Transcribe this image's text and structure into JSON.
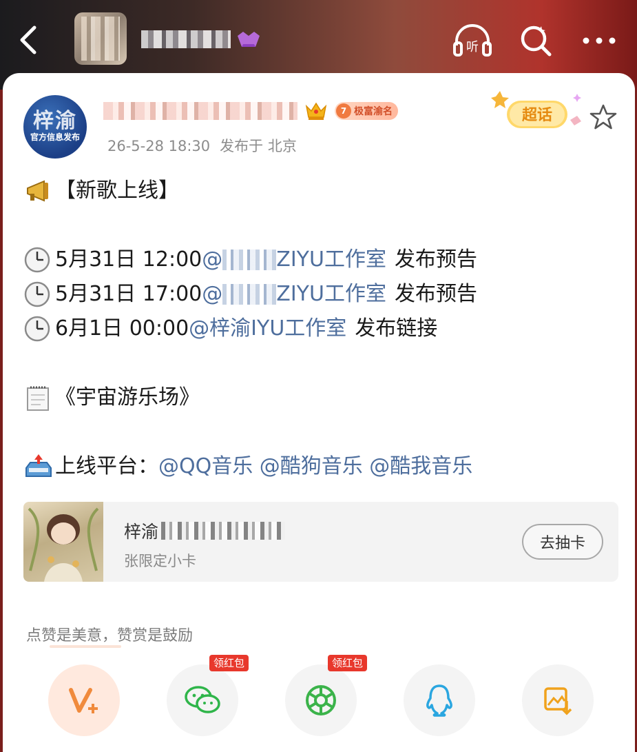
{
  "header": {
    "listen_label": "听"
  },
  "post": {
    "avatar_text_big": "梓渝",
    "avatar_text_small": "官方信息发布",
    "badge_level": "7",
    "badge_label": "极富渝名",
    "timestamp": "26-5-28 18:30",
    "location": "发布于 北京",
    "supertopic_label": "超话",
    "lines": {
      "l1": "【新歌上线】",
      "l2_time": "5月31日 12:00 ",
      "l2_mention": "@",
      "l2_mention_tail": "ZIYU工作室",
      "l2_tail": "发布预告",
      "l3_time": "5月31日 17:00 ",
      "l3_mention": "@",
      "l3_mention_tail": "ZIYU工作室",
      "l3_tail": "发布预告",
      "l4_time": "6月1日 00:00 ",
      "l4_mention": "@梓渝 ",
      "l4_mention_tail": "IYU工作室",
      "l4_tail": "发布链接",
      "l5": "《宇宙游乐场》",
      "l6_prefix": "上线平台：",
      "l6_mentions": "@QQ音乐 @酷狗音乐 @酷我音乐"
    }
  },
  "promo": {
    "title_prefix": "梓渝",
    "subtitle": "张限定小卡",
    "button_label": "去抽卡"
  },
  "tip": "点赞是美意，赞赏是鼓励",
  "actions": {
    "tag_wechat": "领红包",
    "tag_moments": "领红包"
  },
  "colors": {
    "mention": "#4e6e9d",
    "tag_red": "#e8382c",
    "accent_orange": "#f07a40"
  }
}
